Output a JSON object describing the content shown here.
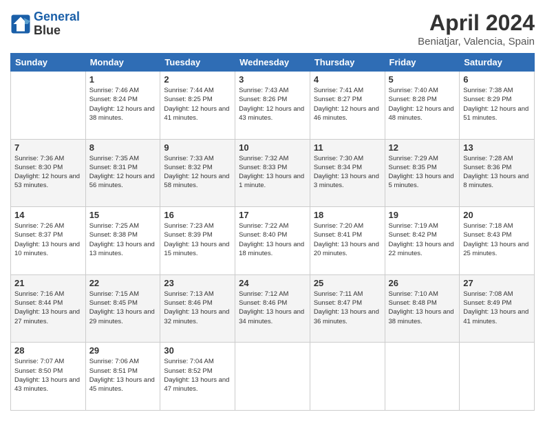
{
  "header": {
    "logo_line1": "General",
    "logo_line2": "Blue",
    "title": "April 2024",
    "subtitle": "Beniatjar, Valencia, Spain"
  },
  "weekdays": [
    "Sunday",
    "Monday",
    "Tuesday",
    "Wednesday",
    "Thursday",
    "Friday",
    "Saturday"
  ],
  "weeks": [
    [
      {
        "day": "",
        "info": ""
      },
      {
        "day": "1",
        "info": "Sunrise: 7:46 AM\nSunset: 8:24 PM\nDaylight: 12 hours\nand 38 minutes."
      },
      {
        "day": "2",
        "info": "Sunrise: 7:44 AM\nSunset: 8:25 PM\nDaylight: 12 hours\nand 41 minutes."
      },
      {
        "day": "3",
        "info": "Sunrise: 7:43 AM\nSunset: 8:26 PM\nDaylight: 12 hours\nand 43 minutes."
      },
      {
        "day": "4",
        "info": "Sunrise: 7:41 AM\nSunset: 8:27 PM\nDaylight: 12 hours\nand 46 minutes."
      },
      {
        "day": "5",
        "info": "Sunrise: 7:40 AM\nSunset: 8:28 PM\nDaylight: 12 hours\nand 48 minutes."
      },
      {
        "day": "6",
        "info": "Sunrise: 7:38 AM\nSunset: 8:29 PM\nDaylight: 12 hours\nand 51 minutes."
      }
    ],
    [
      {
        "day": "7",
        "info": "Sunrise: 7:36 AM\nSunset: 8:30 PM\nDaylight: 12 hours\nand 53 minutes."
      },
      {
        "day": "8",
        "info": "Sunrise: 7:35 AM\nSunset: 8:31 PM\nDaylight: 12 hours\nand 56 minutes."
      },
      {
        "day": "9",
        "info": "Sunrise: 7:33 AM\nSunset: 8:32 PM\nDaylight: 12 hours\nand 58 minutes."
      },
      {
        "day": "10",
        "info": "Sunrise: 7:32 AM\nSunset: 8:33 PM\nDaylight: 13 hours\nand 1 minute."
      },
      {
        "day": "11",
        "info": "Sunrise: 7:30 AM\nSunset: 8:34 PM\nDaylight: 13 hours\nand 3 minutes."
      },
      {
        "day": "12",
        "info": "Sunrise: 7:29 AM\nSunset: 8:35 PM\nDaylight: 13 hours\nand 5 minutes."
      },
      {
        "day": "13",
        "info": "Sunrise: 7:28 AM\nSunset: 8:36 PM\nDaylight: 13 hours\nand 8 minutes."
      }
    ],
    [
      {
        "day": "14",
        "info": "Sunrise: 7:26 AM\nSunset: 8:37 PM\nDaylight: 13 hours\nand 10 minutes."
      },
      {
        "day": "15",
        "info": "Sunrise: 7:25 AM\nSunset: 8:38 PM\nDaylight: 13 hours\nand 13 minutes."
      },
      {
        "day": "16",
        "info": "Sunrise: 7:23 AM\nSunset: 8:39 PM\nDaylight: 13 hours\nand 15 minutes."
      },
      {
        "day": "17",
        "info": "Sunrise: 7:22 AM\nSunset: 8:40 PM\nDaylight: 13 hours\nand 18 minutes."
      },
      {
        "day": "18",
        "info": "Sunrise: 7:20 AM\nSunset: 8:41 PM\nDaylight: 13 hours\nand 20 minutes."
      },
      {
        "day": "19",
        "info": "Sunrise: 7:19 AM\nSunset: 8:42 PM\nDaylight: 13 hours\nand 22 minutes."
      },
      {
        "day": "20",
        "info": "Sunrise: 7:18 AM\nSunset: 8:43 PM\nDaylight: 13 hours\nand 25 minutes."
      }
    ],
    [
      {
        "day": "21",
        "info": "Sunrise: 7:16 AM\nSunset: 8:44 PM\nDaylight: 13 hours\nand 27 minutes."
      },
      {
        "day": "22",
        "info": "Sunrise: 7:15 AM\nSunset: 8:45 PM\nDaylight: 13 hours\nand 29 minutes."
      },
      {
        "day": "23",
        "info": "Sunrise: 7:13 AM\nSunset: 8:46 PM\nDaylight: 13 hours\nand 32 minutes."
      },
      {
        "day": "24",
        "info": "Sunrise: 7:12 AM\nSunset: 8:46 PM\nDaylight: 13 hours\nand 34 minutes."
      },
      {
        "day": "25",
        "info": "Sunrise: 7:11 AM\nSunset: 8:47 PM\nDaylight: 13 hours\nand 36 minutes."
      },
      {
        "day": "26",
        "info": "Sunrise: 7:10 AM\nSunset: 8:48 PM\nDaylight: 13 hours\nand 38 minutes."
      },
      {
        "day": "27",
        "info": "Sunrise: 7:08 AM\nSunset: 8:49 PM\nDaylight: 13 hours\nand 41 minutes."
      }
    ],
    [
      {
        "day": "28",
        "info": "Sunrise: 7:07 AM\nSunset: 8:50 PM\nDaylight: 13 hours\nand 43 minutes."
      },
      {
        "day": "29",
        "info": "Sunrise: 7:06 AM\nSunset: 8:51 PM\nDaylight: 13 hours\nand 45 minutes."
      },
      {
        "day": "30",
        "info": "Sunrise: 7:04 AM\nSunset: 8:52 PM\nDaylight: 13 hours\nand 47 minutes."
      },
      {
        "day": "",
        "info": ""
      },
      {
        "day": "",
        "info": ""
      },
      {
        "day": "",
        "info": ""
      },
      {
        "day": "",
        "info": ""
      }
    ]
  ]
}
